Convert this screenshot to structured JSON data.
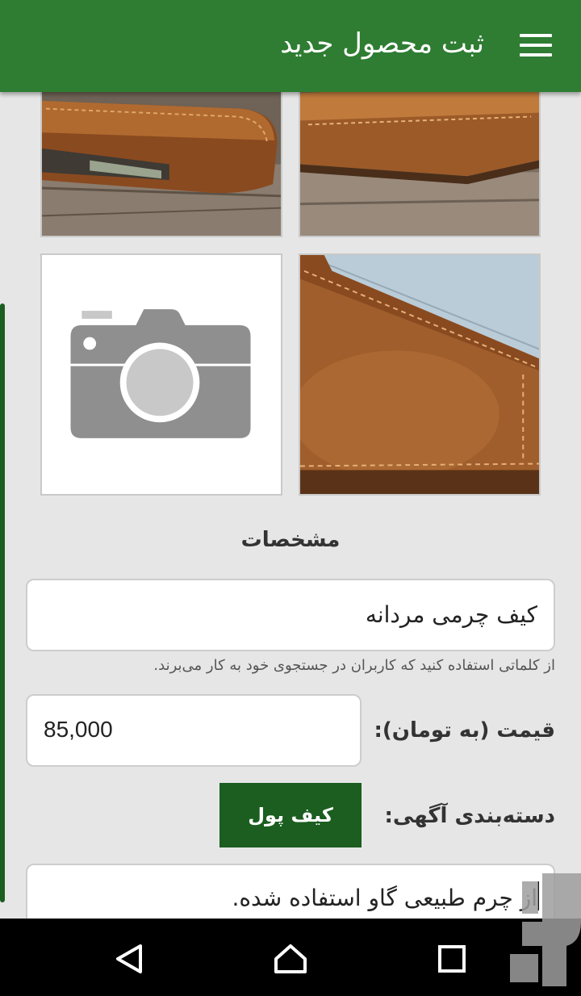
{
  "app_bar": {
    "title": "ثبت محصول جدید",
    "menu_icon": "hamburger-menu-icon",
    "background": "#2e7d32"
  },
  "photos": [
    {
      "name": "product-photo-1",
      "kind": "photo"
    },
    {
      "name": "product-photo-2",
      "kind": "photo"
    },
    {
      "name": "add-photo-placeholder",
      "kind": "camera-icon"
    },
    {
      "name": "product-photo-3",
      "kind": "photo"
    }
  ],
  "specs": {
    "section_title": "مشخصات",
    "product_name": "کیف چرمی مردانه",
    "keyword_hint": "از کلماتی استفاده کنید که کاربران در جستجوی خود به کار می‌برند.",
    "price_label": "قیمت (به تومان):",
    "price_value": "85,000",
    "category_label": "دسته‌بندی آگهی:",
    "category_value": "کیف پول",
    "description": "از چرم طبیعی گاو استفاده شده."
  },
  "colors": {
    "primary": "#2e7d32",
    "primary_dark": "#1b5e20",
    "background": "#e6e6e6"
  },
  "nav_bar": {
    "back_icon": "back-triangle-icon",
    "home_icon": "home-icon",
    "recents_icon": "recents-square-icon"
  }
}
